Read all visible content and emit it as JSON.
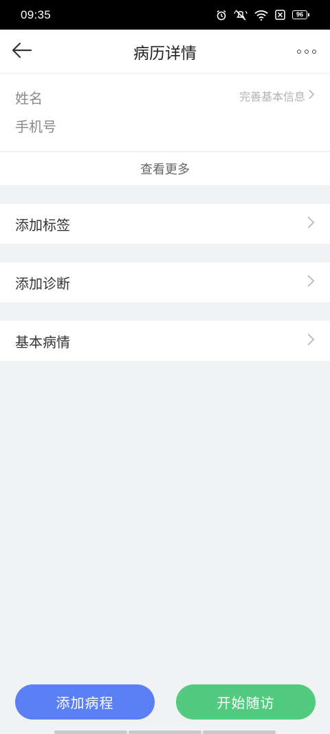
{
  "status_bar": {
    "time": "09:35",
    "battery": "96",
    "icons": [
      "alarm-icon",
      "mute-icon",
      "wifi-icon",
      "sim-off-icon",
      "battery-icon"
    ]
  },
  "header": {
    "title": "病历详情",
    "back_icon": "arrow-left-icon",
    "more_icon": "more-dots-icon"
  },
  "patient_info": {
    "name_label": "姓名",
    "phone_label": "手机号",
    "complete_link": "完善基本信息"
  },
  "view_more": "查看更多",
  "menu": {
    "items": [
      {
        "label": "添加标签"
      },
      {
        "label": "添加诊断"
      },
      {
        "label": "基本病情"
      }
    ]
  },
  "actions": {
    "add_course": "添加病程",
    "start_followup": "开始随访"
  },
  "colors": {
    "primary_blue": "#5b7ff5",
    "primary_green": "#52cb80",
    "background": "#f1f2f4"
  }
}
